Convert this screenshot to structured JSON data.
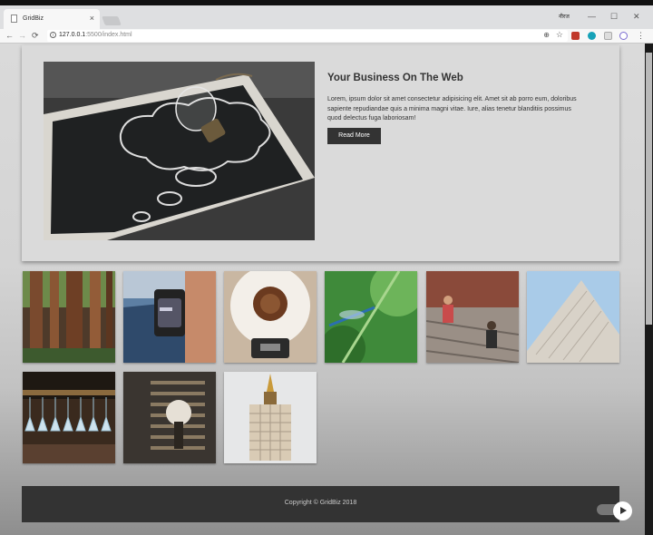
{
  "browser": {
    "tab_title": "GridBiz",
    "tab_close": "×",
    "profile_name": "नीरज",
    "minimize": "—",
    "maximize": "☐",
    "close": "✕",
    "back": "←",
    "forward": "→",
    "reload": "⟳",
    "info": "i",
    "url_host": "127.0.0.1",
    "url_rest": ":5500/index.html",
    "zoom": "⊕",
    "bookmark": "☆",
    "menu": "⋮"
  },
  "feature": {
    "title": "Your Business On The Web",
    "text": "Lorem, ipsum dolor sit amet consectetur adipisicing elit. Amet sit ab porro eum, doloribus sapiente repudiandae quis a minima magni vitae. Iure, alias tenetur blanditiis possimus quod delectus fuga laboriosam!",
    "button_label": "Read More",
    "image": "lightbulb-on-chalkboard"
  },
  "gallery": [
    "redwood-forest",
    "smartwatch-on-wrist",
    "coffee-pour-over",
    "dragonfly-on-stem",
    "woman-on-steps",
    "modern-building",
    "hanging-wine-glasses",
    "person-by-shutters",
    "tall-building-spire"
  ],
  "footer": {
    "text": "Copyright © GridBiz 2018"
  },
  "colors": {
    "page_bg": "#dadada",
    "button_bg": "#333333",
    "footer_bg": "#333333",
    "heading": "#333333"
  }
}
